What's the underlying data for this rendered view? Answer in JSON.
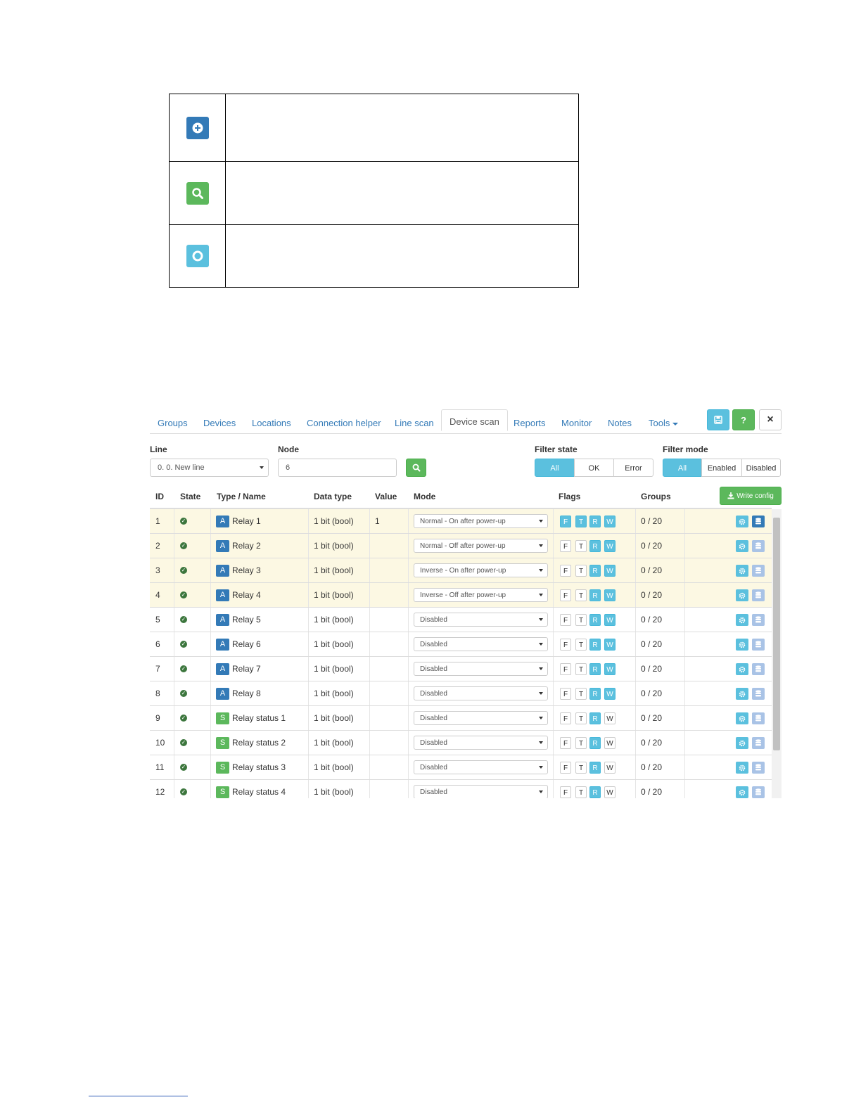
{
  "tabs": [
    {
      "label": "Groups"
    },
    {
      "label": "Devices"
    },
    {
      "label": "Locations"
    },
    {
      "label": "Connection helper"
    },
    {
      "label": "Line scan"
    },
    {
      "label": "Device scan"
    },
    {
      "label": "Reports"
    },
    {
      "label": "Monitor"
    },
    {
      "label": "Notes"
    },
    {
      "label": "Tools"
    }
  ],
  "toolbar": {
    "help_label": "?",
    "close_label": "×"
  },
  "form": {
    "line_label": "Line",
    "line_value": "0. 0. New line",
    "node_label": "Node",
    "node_value": "6",
    "filter_state_label": "Filter state",
    "filter_state_options": [
      "All",
      "OK",
      "Error"
    ],
    "filter_mode_label": "Filter mode",
    "filter_mode_options": [
      "All",
      "Enabled",
      "Disabled"
    ]
  },
  "table": {
    "headers": {
      "id": "ID",
      "state": "State",
      "type_name": "Type / Name",
      "data_type": "Data type",
      "value": "Value",
      "mode": "Mode",
      "flags": "Flags",
      "groups": "Groups"
    },
    "write_config_label": "Write config",
    "flag_labels": [
      "F",
      "T",
      "R",
      "W"
    ],
    "rows": [
      {
        "id": "1",
        "badge": "A",
        "name": "Relay 1",
        "data_type": "1 bit (bool)",
        "value": "1",
        "mode": "Normal - On after power-up",
        "flags": "FTRW",
        "groups": "0 / 20"
      },
      {
        "id": "2",
        "badge": "A",
        "name": "Relay 2",
        "data_type": "1 bit (bool)",
        "value": "",
        "mode": "Normal - Off after power-up",
        "flags": "RW",
        "groups": "0 / 20"
      },
      {
        "id": "3",
        "badge": "A",
        "name": "Relay 3",
        "data_type": "1 bit (bool)",
        "value": "",
        "mode": "Inverse - On after power-up",
        "flags": "RW",
        "groups": "0 / 20"
      },
      {
        "id": "4",
        "badge": "A",
        "name": "Relay 4",
        "data_type": "1 bit (bool)",
        "value": "",
        "mode": "Inverse - Off after power-up",
        "flags": "RW",
        "groups": "0 / 20"
      },
      {
        "id": "5",
        "badge": "A",
        "name": "Relay 5",
        "data_type": "1 bit (bool)",
        "value": "",
        "mode": "Disabled",
        "flags": "RW",
        "groups": "0 / 20"
      },
      {
        "id": "6",
        "badge": "A",
        "name": "Relay 6",
        "data_type": "1 bit (bool)",
        "value": "",
        "mode": "Disabled",
        "flags": "RW",
        "groups": "0 / 20"
      },
      {
        "id": "7",
        "badge": "A",
        "name": "Relay 7",
        "data_type": "1 bit (bool)",
        "value": "",
        "mode": "Disabled",
        "flags": "RW",
        "groups": "0 / 20"
      },
      {
        "id": "8",
        "badge": "A",
        "name": "Relay 8",
        "data_type": "1 bit (bool)",
        "value": "",
        "mode": "Disabled",
        "flags": "RW",
        "groups": "0 / 20"
      },
      {
        "id": "9",
        "badge": "S",
        "name": "Relay status 1",
        "data_type": "1 bit (bool)",
        "value": "",
        "mode": "Disabled",
        "flags": "R",
        "groups": "0 / 20"
      },
      {
        "id": "10",
        "badge": "S",
        "name": "Relay status 2",
        "data_type": "1 bit (bool)",
        "value": "",
        "mode": "Disabled",
        "flags": "R",
        "groups": "0 / 20"
      },
      {
        "id": "11",
        "badge": "S",
        "name": "Relay status 3",
        "data_type": "1 bit (bool)",
        "value": "",
        "mode": "Disabled",
        "flags": "R",
        "groups": "0 / 20"
      },
      {
        "id": "12",
        "badge": "S",
        "name": "Relay status 4",
        "data_type": "1 bit (bool)",
        "value": "",
        "mode": "Disabled",
        "flags": "R",
        "groups": "0 / 20"
      }
    ]
  },
  "colors": {
    "primary": "#337ab7",
    "success": "#5cb85c",
    "info": "#5bc0de",
    "warning_row": "#fcf8e3",
    "ok_icon": "#3c763d"
  },
  "icons": {
    "legend": [
      "plus-circle-icon",
      "search-icon",
      "circle-icon"
    ],
    "toolbar": [
      "save-icon",
      "help-icon",
      "close-icon"
    ],
    "row_actions": [
      "gear-icon",
      "database-icon"
    ]
  }
}
